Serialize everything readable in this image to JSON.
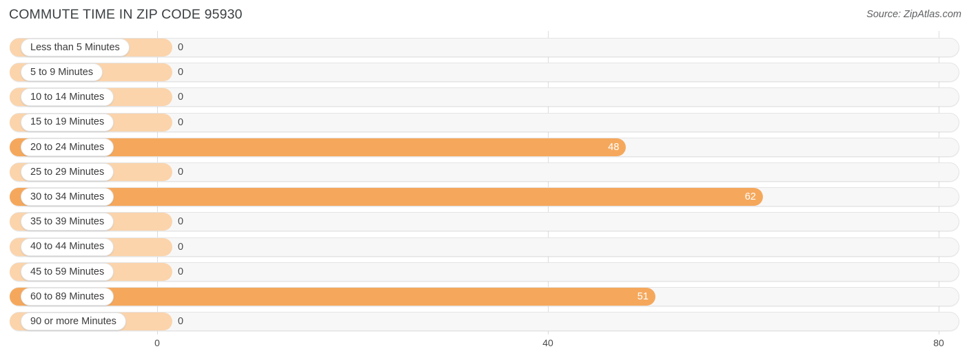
{
  "header": {
    "title": "COMMUTE TIME IN ZIP CODE 95930",
    "source": "Source: ZipAtlas.com"
  },
  "axis": {
    "ticks": [
      "0",
      "40",
      "80"
    ]
  },
  "colors": {
    "bar_filled": "#f5a85c",
    "bar_zero": "#fbd4ac",
    "track": "#f7f7f7",
    "gridline": "#dcdcdc",
    "title": "#3c4043"
  },
  "chart_data": {
    "type": "bar",
    "orientation": "horizontal",
    "title": "COMMUTE TIME IN ZIP CODE 95930",
    "xlabel": "",
    "ylabel": "",
    "xlim": [
      0,
      80
    ],
    "xticks": [
      0,
      40,
      80
    ],
    "grid": true,
    "legend": null,
    "categories": [
      "Less than 5 Minutes",
      "5 to 9 Minutes",
      "10 to 14 Minutes",
      "15 to 19 Minutes",
      "20 to 24 Minutes",
      "25 to 29 Minutes",
      "30 to 34 Minutes",
      "35 to 39 Minutes",
      "40 to 44 Minutes",
      "45 to 59 Minutes",
      "60 to 89 Minutes",
      "90 or more Minutes"
    ],
    "values": [
      0,
      0,
      0,
      0,
      48,
      0,
      62,
      0,
      0,
      0,
      51,
      0
    ],
    "value_labels": [
      "0",
      "0",
      "0",
      "0",
      "48",
      "0",
      "62",
      "0",
      "0",
      "0",
      "51",
      "0"
    ]
  },
  "rows": [
    {
      "label": "Less than 5 Minutes",
      "value": 0,
      "value_label": "0"
    },
    {
      "label": "5 to 9 Minutes",
      "value": 0,
      "value_label": "0"
    },
    {
      "label": "10 to 14 Minutes",
      "value": 0,
      "value_label": "0"
    },
    {
      "label": "15 to 19 Minutes",
      "value": 0,
      "value_label": "0"
    },
    {
      "label": "20 to 24 Minutes",
      "value": 48,
      "value_label": "48"
    },
    {
      "label": "25 to 29 Minutes",
      "value": 0,
      "value_label": "0"
    },
    {
      "label": "30 to 34 Minutes",
      "value": 62,
      "value_label": "62"
    },
    {
      "label": "35 to 39 Minutes",
      "value": 0,
      "value_label": "0"
    },
    {
      "label": "40 to 44 Minutes",
      "value": 0,
      "value_label": "0"
    },
    {
      "label": "45 to 59 Minutes",
      "value": 0,
      "value_label": "0"
    },
    {
      "label": "60 to 89 Minutes",
      "value": 51,
      "value_label": "51"
    },
    {
      "label": "90 or more Minutes",
      "value": 0,
      "value_label": "0"
    }
  ]
}
